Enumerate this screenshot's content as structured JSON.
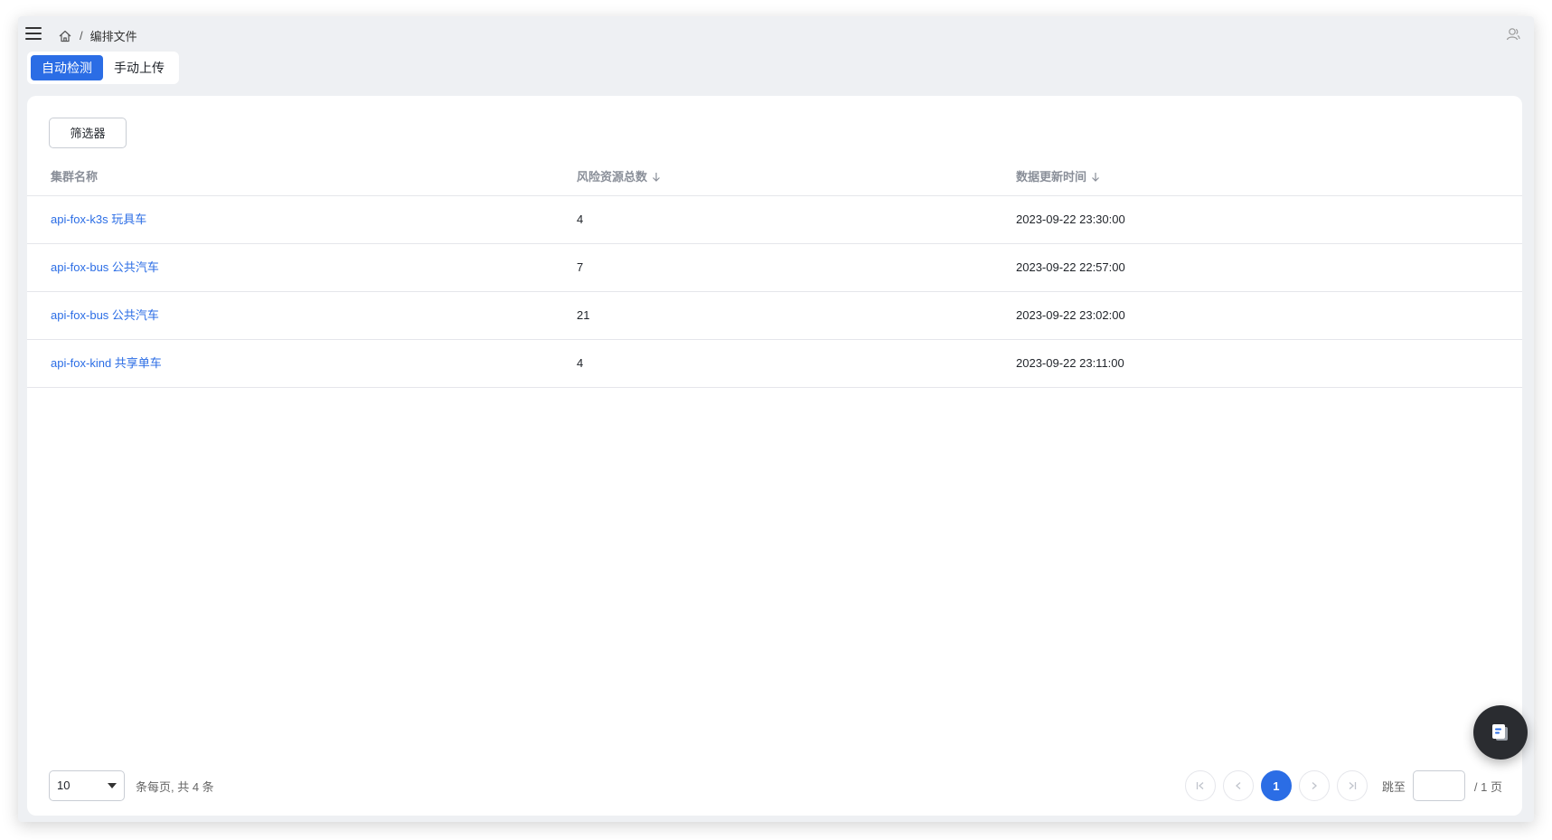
{
  "breadcrumb": {
    "home_icon": "home-icon",
    "separator": "/",
    "current": "编排文件"
  },
  "tabs": [
    {
      "label": "自动检测",
      "active": true
    },
    {
      "label": "手动上传",
      "active": false
    }
  ],
  "filter": {
    "label": "筛选器"
  },
  "table": {
    "columns": [
      {
        "label": "集群名称",
        "sortable": false
      },
      {
        "label": "风险资源总数",
        "sortable": true
      },
      {
        "label": "数据更新时间",
        "sortable": true
      }
    ],
    "rows": [
      {
        "name": "api-fox-k3s 玩具车",
        "count": "4",
        "updated": "2023-09-22 23:30:00"
      },
      {
        "name": "api-fox-bus 公共汽车",
        "count": "7",
        "updated": "2023-09-22 22:57:00"
      },
      {
        "name": "api-fox-bus 公共汽车",
        "count": "21",
        "updated": "2023-09-22 23:02:00"
      },
      {
        "name": "api-fox-kind 共享单车",
        "count": "4",
        "updated": "2023-09-22 23:11:00"
      }
    ]
  },
  "pagination": {
    "page_size": "10",
    "total_text": "条每页, 共 4 条",
    "current_page": "1",
    "jump_label": "跳至",
    "jump_value": "",
    "pages_text": "/ 1 页"
  },
  "colors": {
    "accent": "#2b6de5",
    "page_bg": "#eef0f3",
    "fab_bg": "#2a2c30"
  },
  "icons": {
    "menu": "hamburger-icon",
    "user": "user-icon",
    "fab": "document-icon"
  }
}
